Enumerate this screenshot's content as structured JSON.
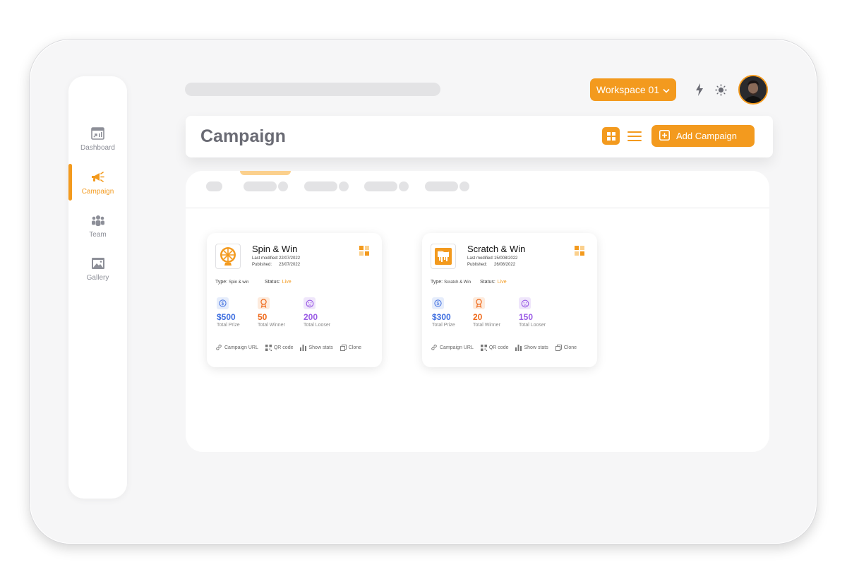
{
  "sidebar": {
    "items": [
      {
        "label": "Dashboard",
        "icon": "dashboard-icon",
        "active": false
      },
      {
        "label": "Campaign",
        "icon": "megaphone-icon",
        "active": true
      },
      {
        "label": "Team",
        "icon": "team-icon",
        "active": false
      },
      {
        "label": "Gallery",
        "icon": "gallery-icon",
        "active": false
      }
    ]
  },
  "topbar": {
    "workspace_label": "Workspace 01",
    "icons": [
      "lightning-icon",
      "sun-icon",
      "avatar"
    ]
  },
  "header": {
    "title": "Campaign",
    "add_label": "Add Campaign"
  },
  "colors": {
    "accent": "#f39a1e",
    "prize": "#3f6fe0",
    "winner": "#ef6a1c",
    "looser": "#9b5de5"
  },
  "cards": [
    {
      "title": "Spin & Win",
      "last_modified_label": "Last modified:",
      "last_modified": "22/07/2022",
      "published_label": "Published:",
      "published": "23/07/2022",
      "type_label": "Type:",
      "type": "Spin & win",
      "status_label": "Status:",
      "status": "Live",
      "stats": [
        {
          "value": "$500",
          "label": "Total Prize"
        },
        {
          "value": "50",
          "label": "Total Winner"
        },
        {
          "value": "200",
          "label": "Total Looser"
        }
      ],
      "actions": [
        "Campaign URL",
        "QR code",
        "Show stats",
        "Clone"
      ]
    },
    {
      "title": "Scratch & Win",
      "last_modified_label": "Last modified:",
      "last_modified": "15/008/2022",
      "published_label": "Published:",
      "published": "26/08/2022",
      "type_label": "Type:",
      "type": "Scratch & Win",
      "status_label": "Status:",
      "status": "Live",
      "stats": [
        {
          "value": "$300",
          "label": "Total Prize"
        },
        {
          "value": "20",
          "label": "Total Winner"
        },
        {
          "value": "150",
          "label": "Total Looser"
        }
      ],
      "actions": [
        "Campaign URL",
        "QR code",
        "Show stats",
        "Clone"
      ]
    }
  ]
}
